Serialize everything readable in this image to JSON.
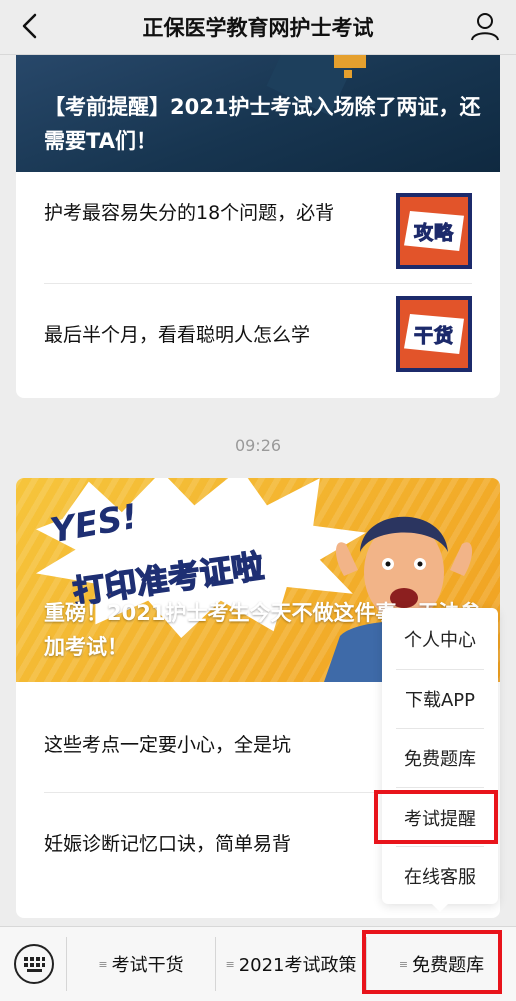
{
  "header": {
    "title": "正保医学教育网护士考试",
    "back_icon": "chevron-left-icon",
    "profile_icon": "user-icon"
  },
  "article_group_1": {
    "headline": "【考前提醒】2021护士考试入场除了两证，还需要TA们！",
    "items": [
      {
        "text": "护考最容易失分的18个问题，必背",
        "thumb_label": "攻略"
      },
      {
        "text": "最后半个月，看看聪明人怎么学",
        "thumb_label": "干货"
      }
    ]
  },
  "timestamp": "09:26",
  "article_group_2": {
    "banner_yes": "YES!",
    "banner_slogan": "打印准考证啦",
    "headline": "重磅！2021护士考生今天不做这件事，无法参加考试！",
    "items": [
      {
        "text": "这些考点一定要小心，全是坑"
      },
      {
        "text": "妊娠诊断记忆口诀，简单易背"
      }
    ]
  },
  "popup_menu": {
    "items": [
      "个人中心",
      "下载APP",
      "免费题库",
      "考试提醒",
      "在线客服"
    ],
    "highlighted": "考试提醒"
  },
  "bottom_bar": {
    "keyboard_icon": "keyboard-icon",
    "menus": [
      "考试干货",
      "2021考试政策",
      "免费题库"
    ],
    "highlighted": "免费题库"
  },
  "colors": {
    "highlight_box": "#e8141b",
    "background": "#ededed"
  }
}
